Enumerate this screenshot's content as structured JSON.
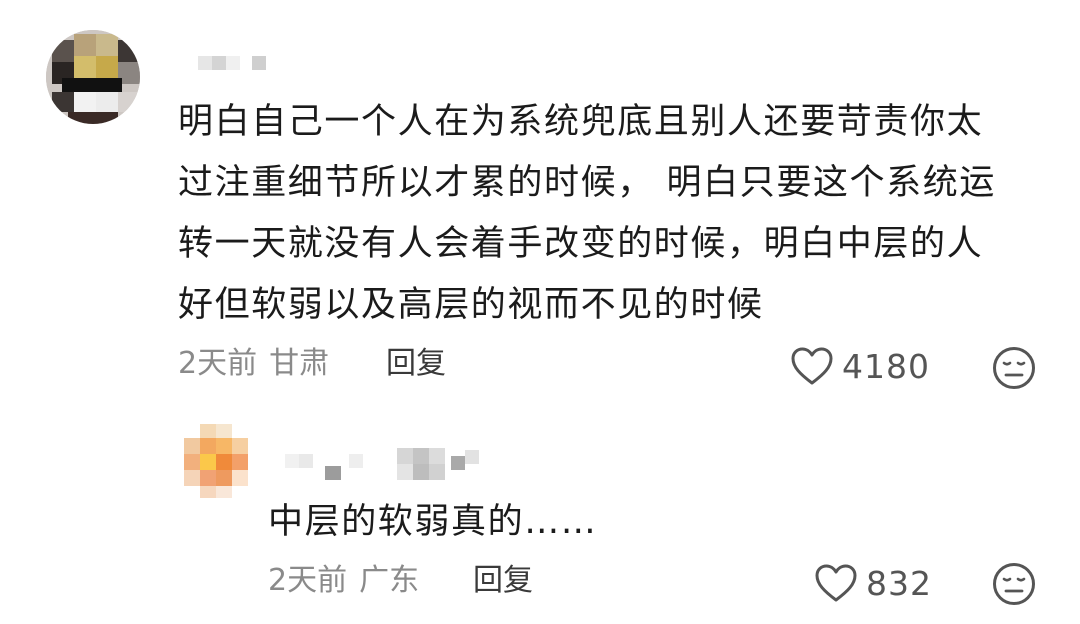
{
  "comments": [
    {
      "avatar_icon": "pixelated-avatar",
      "username_icon": "pixelated-username",
      "text_lines": [
        "明白自己一个人在为系统兜底且别人还要苛责你太",
        "过注重细节所以才累的时候， 明白只要这个系统运",
        "转一天就没有人会着手改变的时候，明白中层的人",
        "好但软弱以及高层的视而不见的时候"
      ],
      "time": "2天前",
      "location": "甘肃",
      "reply_label": "回复",
      "like_count": "4180",
      "like_icon": "heart-outline-icon",
      "dislike_icon": "neutral-face-icon"
    },
    {
      "avatar_icon": "pixelated-avatar",
      "username_icon": "pixelated-username",
      "text": "中层的软弱真的……",
      "time": "2天前",
      "location": "广东",
      "reply_label": "回复",
      "like_count": "832",
      "like_icon": "heart-outline-icon",
      "dislike_icon": "neutral-face-icon"
    }
  ],
  "colors": {
    "text": "#1b1b1b",
    "meta": "#8a8a8a",
    "reply": "#3a3a3a",
    "icon": "#555555"
  }
}
